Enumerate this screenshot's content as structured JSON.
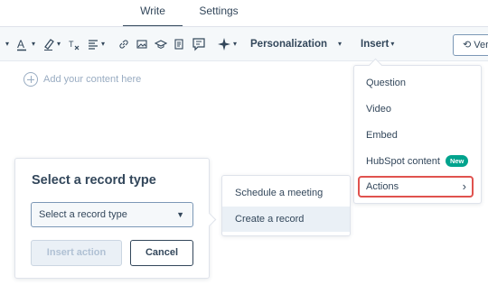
{
  "tabs": [
    {
      "label": "Write",
      "active": true
    },
    {
      "label": "Settings",
      "active": false
    }
  ],
  "toolbar": {
    "personalization_label": "Personalization",
    "insert_label": "Insert",
    "version_label": "Ver"
  },
  "editor": {
    "placeholder": "Add your content here"
  },
  "insert_menu": {
    "items": [
      "Question",
      "Video",
      "Embed",
      "HubSpot content",
      "Actions"
    ],
    "new_badge": "New",
    "highlight_color": "#e0524e"
  },
  "actions_submenu": {
    "items": [
      "Schedule a meeting",
      "Create a record"
    ]
  },
  "record_popover": {
    "title": "Select a record type",
    "select_value": "Select a record type",
    "insert_button": "Insert action",
    "cancel_button": "Cancel"
  },
  "colors": {
    "text": "#33475b",
    "badge": "#00a38d",
    "toolbar_bg": "#f5f8fa",
    "selected_bg": "#eaf0f6"
  }
}
